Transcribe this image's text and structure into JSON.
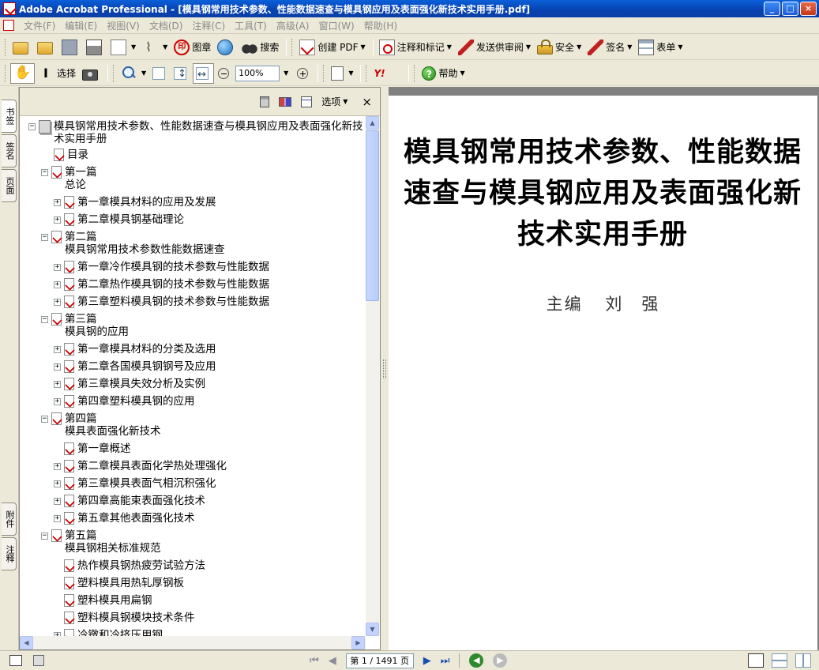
{
  "window": {
    "title": "Adobe Acrobat Professional - [模具钢常用技术参数、性能数据速查与模具钢应用及表面强化新技术实用手册.pdf]",
    "controls": [
      "_",
      "□",
      "×"
    ]
  },
  "menubar": {
    "items": [
      "文件(F)",
      "编辑(E)",
      "视图(V)",
      "文档(D)",
      "注释(C)",
      "工具(T)",
      "高级(A)",
      "窗口(W)",
      "帮助(H)"
    ]
  },
  "toolbar1": {
    "stamp_label": "图章",
    "search_label": "搜索",
    "create_pdf_label": "创建 PDF",
    "comment_label": "注释和标记",
    "send_review_label": "发送供审阅",
    "security_label": "安全",
    "sign_label": "签名",
    "forms_label": "表单"
  },
  "toolbar2": {
    "select_label": "选择",
    "zoom_value": "100%",
    "help_label": "帮助",
    "yahoo_label": "Y!"
  },
  "left_tabs": {
    "bookmarks": "书签",
    "signatures": "签名",
    "pages": "页面",
    "attachments": "附件",
    "comments": "注释"
  },
  "bookmarks_panel": {
    "options_label": "选项",
    "close_label": "×",
    "root": "模具钢常用技术参数、性能数据速查与模具钢应用及表面强化新技术实用手册",
    "toc": "目录",
    "parts": [
      {
        "title": "第一篇",
        "subtitle": "总论",
        "chapters": [
          "第一章模具材料的应用及发展",
          "第二章模具钢基础理论"
        ]
      },
      {
        "title": "第二篇",
        "subtitle": "模具钢常用技术参数性能数据速查",
        "chapters": [
          "第一章冷作模具钢的技术参数与性能数据",
          "第二章热作模具钢的技术参数与性能数据",
          "第三章塑料模具钢的技术参数与性能数据"
        ]
      },
      {
        "title": "第三篇",
        "subtitle": "模具钢的应用",
        "chapters": [
          "第一章模具材料的分类及选用",
          "第二章各国模具钢钢号及应用",
          "第三章模具失效分析及实例",
          "第四章塑料模具钢的应用"
        ]
      },
      {
        "title": "第四篇",
        "subtitle": "模具表面强化新技术",
        "chapters": [
          "第一章概述",
          "第二章模具表面化学热处理强化",
          "第三章模具表面气相沉积强化",
          "第四章高能束表面强化技术",
          "第五章其他表面强化技术"
        ]
      },
      {
        "title": "第五篇",
        "subtitle": "模具钢相关标准规范",
        "chapters": [
          "热作模具钢热疲劳试验方法",
          "塑料模具用热轧厚钢板",
          "塑料模具用扁钢",
          "塑料模具钢模块技术条件",
          "冷镦和冷挤压用钢"
        ]
      }
    ]
  },
  "document": {
    "title": "模具钢常用技术参数、性能数据速查与模具钢应用及表面强化新技术实用手册",
    "editor_role": "主编",
    "editor_name": "刘　强"
  },
  "statusbar": {
    "page_display": "第 1 / 1491 页",
    "current_page": 1,
    "total_pages": 1491
  }
}
